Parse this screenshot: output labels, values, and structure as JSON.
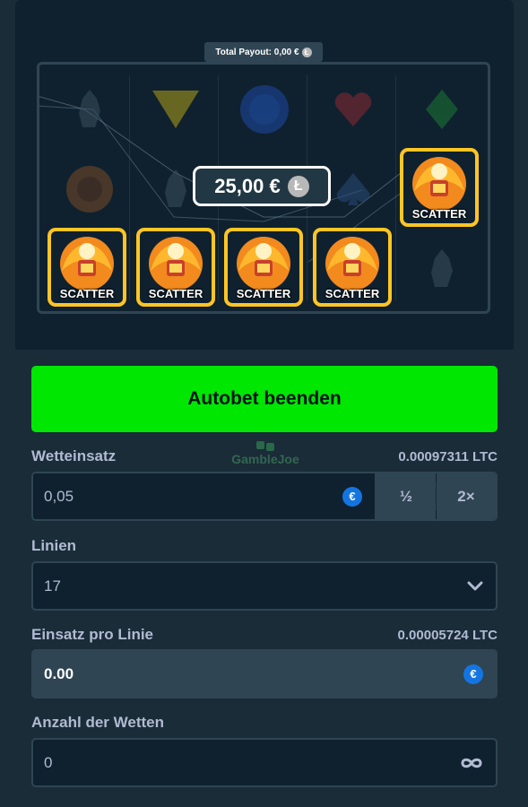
{
  "game": {
    "total_payout_label": "Total Payout: 0,00 €",
    "win_amount": "25,00 €",
    "scatter_label": "SCATTER",
    "currency_coin": "Ł"
  },
  "autobet": {
    "stop_button_label": "Autobet beenden"
  },
  "bet": {
    "label": "Wetteinsatz",
    "converted": "0.00097311 LTC",
    "value": "0,05",
    "currency_symbol": "€",
    "half_label": "½",
    "double_label": "2×"
  },
  "lines": {
    "label": "Linien",
    "selected": "17"
  },
  "per_line": {
    "label": "Einsatz pro Linie",
    "converted": "0.00005724 LTC",
    "value": "0.00",
    "currency_symbol": "€"
  },
  "bets_count": {
    "label": "Anzahl der Wetten",
    "value": "0"
  },
  "watermark": "GambleJoe",
  "colors": {
    "background": "#1a2c38",
    "panel": "#0f212e",
    "accent_green": "#00e701",
    "scatter_border": "#ffc524",
    "euro_blue": "#1475e1"
  },
  "icons": [
    "litecoin-icon",
    "euro-icon",
    "chevron-down-icon",
    "infinity-icon",
    "scatter-icon"
  ]
}
